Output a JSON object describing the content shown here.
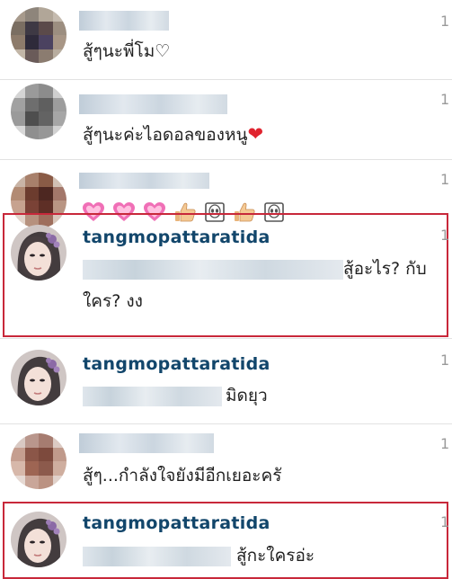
{
  "comments": [
    {
      "username": "",
      "text": "สู้ๆนะพี่โม♡",
      "time": "1"
    },
    {
      "username": "",
      "text": "สู้ๆนะค่ะไอดอลของหนู",
      "heart": "❤",
      "time": "1"
    },
    {
      "username": "",
      "emoji_icons": [
        "pink-heart-icon",
        "pink-heart-icon",
        "pink-heart-icon",
        "thumbs-up-icon",
        "alien-face-icon",
        "thumbs-up-icon",
        "alien-face-icon"
      ],
      "time": "1"
    },
    {
      "username": "tangmopattaratida",
      "text_line1": "สู้อะไร? กับ",
      "text_line2": "ใคร? งง",
      "time": "1"
    },
    {
      "username": "tangmopattaratida",
      "text": "มิดยุว",
      "time": "1"
    },
    {
      "username": "",
      "text": "สู้ๆ...กำลังใจยังมีอีกเยอะครั",
      "time": "1"
    },
    {
      "username": "tangmopattaratida",
      "text": "สู้กะใครอ่ะ",
      "time": "1"
    }
  ],
  "colors": {
    "username": "#12466b",
    "highlight_border": "#c8283a",
    "separator": "#e2e2e2"
  }
}
